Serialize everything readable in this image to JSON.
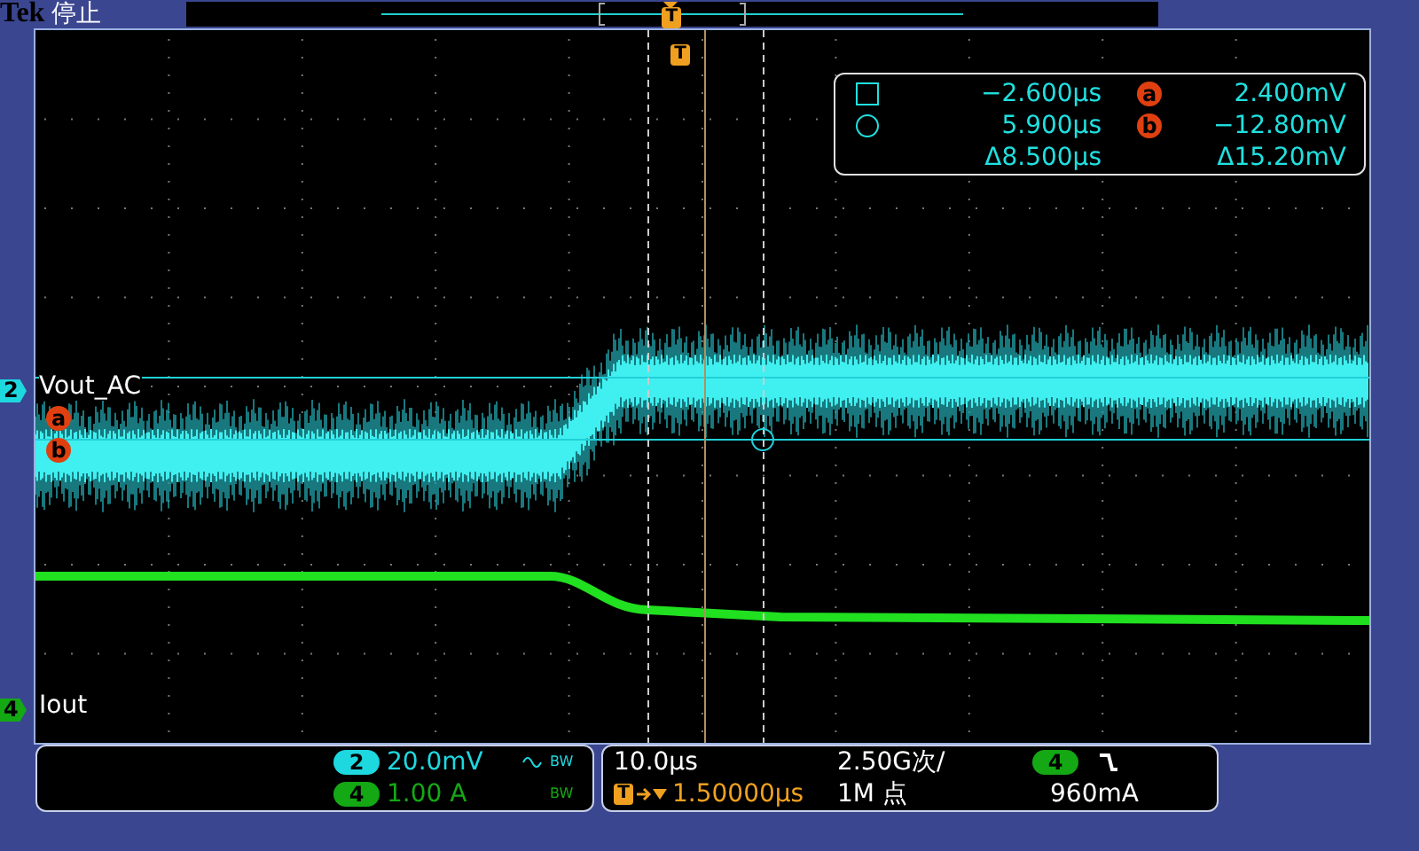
{
  "header": {
    "brand": "Tek",
    "state": "停止"
  },
  "record_view": {
    "trigger_marker": "T"
  },
  "graticule": {
    "trigger_marker": "T"
  },
  "channels": [
    {
      "number": "2",
      "label": "Vout_AC",
      "color": "#1ed8e0"
    },
    {
      "number": "4",
      "label": "Iout",
      "color": "#14a814"
    }
  ],
  "cursor_markers": [
    "a",
    "b"
  ],
  "cursor_readout": [
    {
      "kind": "square",
      "time": "−2.600µs",
      "marker": "a",
      "value": "2.400mV"
    },
    {
      "kind": "circle",
      "time": "5.900µs",
      "marker": "b",
      "value": "−12.80mV"
    },
    {
      "kind": "delta",
      "time": "Δ8.500µs",
      "value": "Δ15.20mV"
    }
  ],
  "vertical_settings": [
    {
      "channel": "2",
      "color": "#1ed8e0",
      "scale": "20.0mV",
      "ac_coupled": true,
      "bw_limit": "BW"
    },
    {
      "channel": "4",
      "color": "#14a814",
      "scale": "1.00 A",
      "ac_coupled": false,
      "bw_limit": "BW"
    }
  ],
  "horizontal": {
    "scale": "10.0µs",
    "sample_rate": "2.50G次/",
    "trigger_marker": "T",
    "trigger_position": "1.50000µs",
    "record_length": "1M 点"
  },
  "trigger": {
    "source": "4",
    "color": "#14a814",
    "falling_edge": true,
    "level": "960mA"
  }
}
